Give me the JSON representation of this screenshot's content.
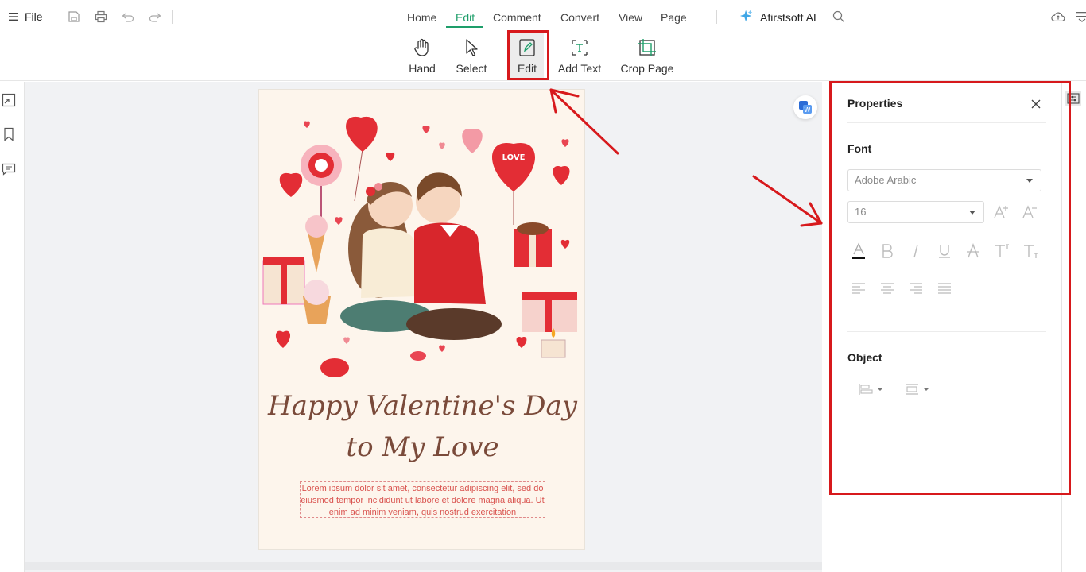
{
  "topbar": {
    "file_label": "File",
    "tabs": [
      {
        "label": "Home"
      },
      {
        "label": "Edit",
        "active": true
      },
      {
        "label": "Comment"
      },
      {
        "label": "Convert"
      },
      {
        "label": "View"
      },
      {
        "label": "Page"
      }
    ],
    "ai_label": "Afirstsoft AI",
    "icons": [
      "hamburger-icon",
      "save-icon",
      "print-icon",
      "undo-icon",
      "redo-icon",
      "sparkle-icon",
      "search-icon",
      "cloud-upload-icon",
      "menu-collapse-icon"
    ]
  },
  "ribbon": {
    "tools": [
      {
        "label": "Hand",
        "icon": "hand-icon"
      },
      {
        "label": "Select",
        "icon": "cursor-icon"
      },
      {
        "label": "Edit",
        "icon": "edit-icon",
        "selected": true
      },
      {
        "label": "Add Text",
        "icon": "add-text-icon"
      },
      {
        "label": "Crop Page",
        "icon": "crop-icon"
      }
    ]
  },
  "leftrail": {
    "icons": [
      "thumbnail-icon",
      "bookmark-icon",
      "comment-icon"
    ]
  },
  "document": {
    "heading_line1": "Happy Valentine's Day",
    "heading_line2": "to My Love",
    "balloon_text": "LOVE",
    "body_text": "Lorem ipsum dolor sit amet, consectetur adipiscing elit, sed do eiusmod tempor incididunt ut labore et dolore magna aliqua. Ut enim ad minim veniam, quis nostrud exercitation"
  },
  "properties": {
    "title": "Properties",
    "font_section": "Font",
    "font_family_value": "Adobe Arabic",
    "font_size_value": "16",
    "object_section": "Object",
    "format_icons": [
      "font-color-icon",
      "bold-icon",
      "italic-icon",
      "underline-icon",
      "strikethrough-icon",
      "superscript-icon",
      "subscript-icon"
    ],
    "align_icons": [
      "align-left-icon",
      "align-center-icon",
      "align-right-icon",
      "justify-icon"
    ]
  },
  "colors": {
    "accent": "#1e9e6a",
    "annotation_red": "#d7191c",
    "page_bg": "#fdf5ec"
  }
}
